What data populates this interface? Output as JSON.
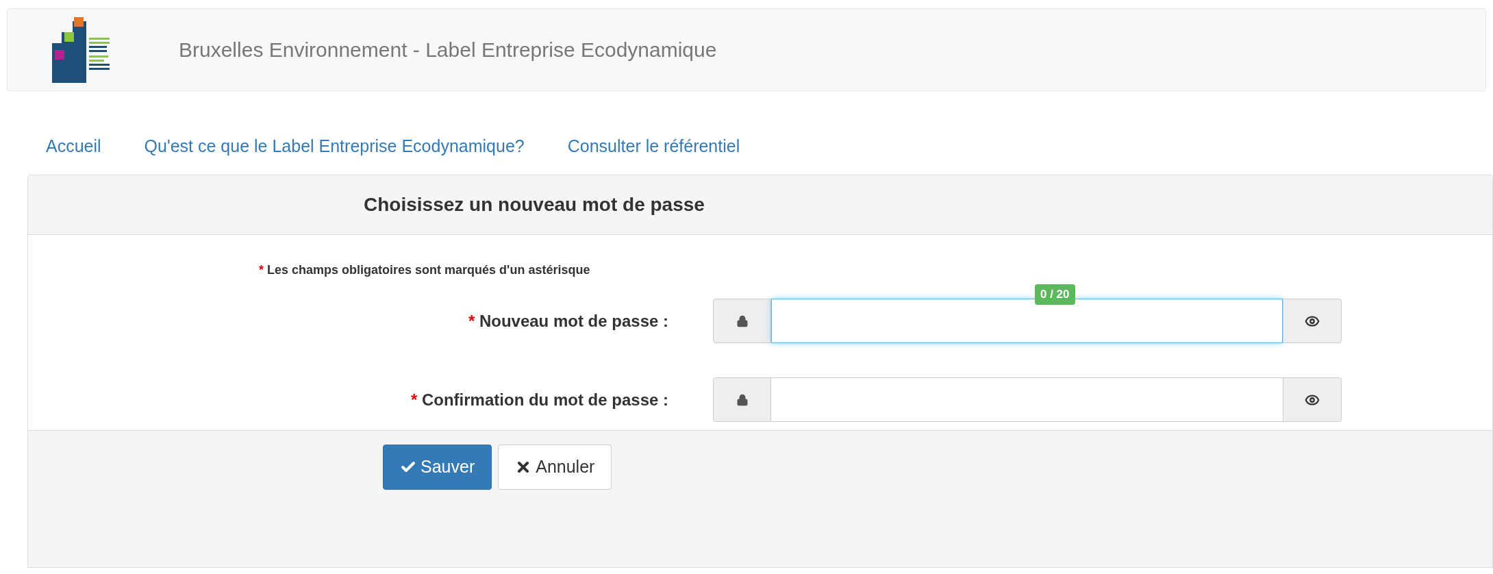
{
  "header": {
    "title": "Bruxelles Environnement - Label Entreprise Ecodynamique"
  },
  "nav": [
    {
      "label": "Accueil"
    },
    {
      "label": "Qu'est ce que le Label Entreprise Ecodynamique?"
    },
    {
      "label": "Consulter le référentiel"
    }
  ],
  "panel": {
    "title": "Choisissez un nouveau mot de passe",
    "required_mark": "*",
    "note": "Les champs obligatoires sont marqués d'un astérisque",
    "fields": [
      {
        "label": "Nouveau mot de passe :",
        "required": true,
        "focused": true,
        "counter": "0 / 20"
      },
      {
        "label": "Confirmation du mot de passe :",
        "required": true,
        "focused": false
      }
    ],
    "buttons": [
      {
        "kind": "primary",
        "label": "Sauver"
      },
      {
        "kind": "default",
        "label": "Annuler"
      }
    ]
  }
}
